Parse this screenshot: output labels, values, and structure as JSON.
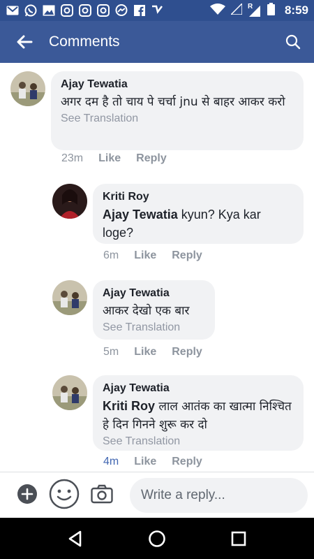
{
  "status_bar": {
    "time": "8:59",
    "icons": [
      "gmail-icon",
      "whatsapp-icon",
      "gallery-icon",
      "instagram-icon",
      "instagram-icon",
      "instagram-icon",
      "messenger-icon",
      "facebook-icon",
      "check-icon",
      "wifi-icon",
      "signal-icon",
      "signal-roaming-icon",
      "battery-icon"
    ],
    "roaming_badge": "R"
  },
  "app_bar": {
    "title": "Comments"
  },
  "comments": [
    {
      "author": "Ajay Tewatia",
      "text": "अगर दम है तो चाय पे चर्चा jnu से बाहर आकर करो",
      "see_translation": "See Translation",
      "time": "23m",
      "like": "Like",
      "reply": "Reply"
    },
    {
      "author": "Kriti Roy",
      "mention": "Ajay Tewatia",
      "text": "kyun? Kya kar loge?",
      "time": "6m",
      "like": "Like",
      "reply": "Reply"
    },
    {
      "author": "Ajay Tewatia",
      "text": "आकर देखो एक बार",
      "see_translation": "See Translation",
      "time": "5m",
      "like": "Like",
      "reply": "Reply"
    },
    {
      "author": "Ajay Tewatia",
      "mention": "Kriti Roy",
      "text": "लाल आतंक का खात्मा निश्चित हे दिन गिनने शुरू कर दो",
      "see_translation": "See Translation",
      "time": "4m",
      "like": "Like",
      "reply": "Reply"
    }
  ],
  "composer": {
    "placeholder": "Write a reply..."
  },
  "colors": {
    "status_bar": "#2f4f8f",
    "app_bar": "#3b5998",
    "bubble": "#f1f2f4",
    "link_blue": "#4267b2"
  }
}
